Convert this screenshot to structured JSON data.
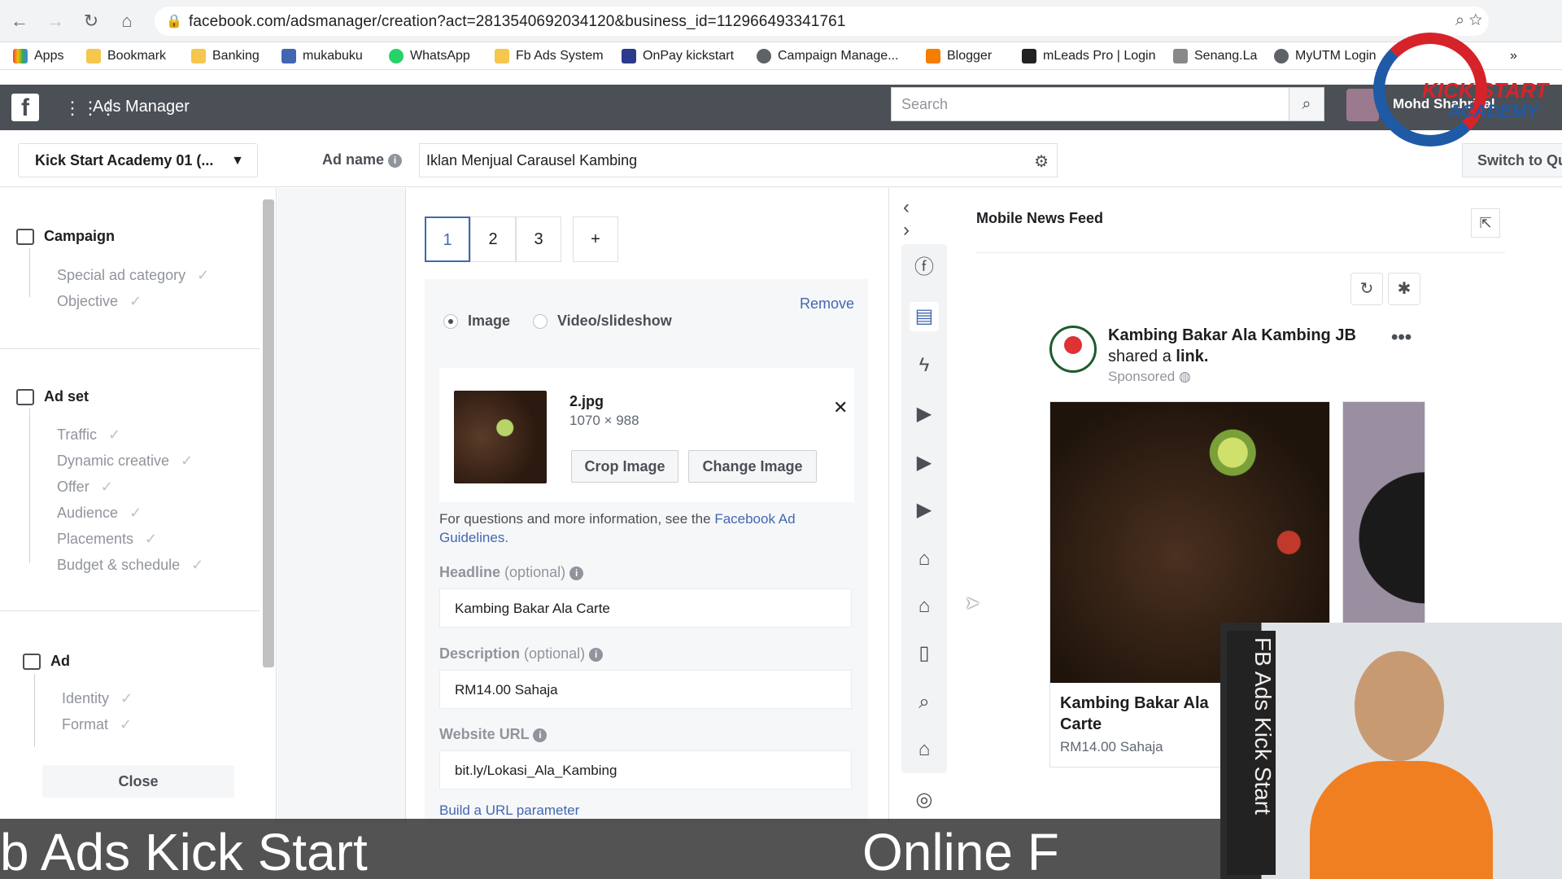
{
  "browser": {
    "url": "facebook.com/adsmanager/creation?act=2813540692034120&business_id=112966493341761",
    "bookmarks": [
      "Apps",
      "Bookmark",
      "Banking",
      "mukabuku",
      "WhatsApp",
      "Fb Ads System",
      "OnPay kickstart",
      "Campaign Manage...",
      "Blogger",
      "mLeads Pro | Login",
      "Senang.La",
      "MyUTM Login"
    ],
    "more": "»"
  },
  "header": {
    "app_title": "Ads Manager",
    "search_placeholder": "Search",
    "user_name": "Mohd Shahrizal"
  },
  "adname_row": {
    "account": "Kick Start Academy 01 (...",
    "label": "Ad name",
    "value": "Iklan Menjual Carausel Kambing",
    "switch_label": "Switch to Qu"
  },
  "leftnav": {
    "campaign": {
      "title": "Campaign",
      "items": [
        "Special ad category",
        "Objective"
      ]
    },
    "adset": {
      "title": "Ad set",
      "items": [
        "Traffic",
        "Dynamic creative",
        "Offer",
        "Audience",
        "Placements",
        "Budget & schedule"
      ]
    },
    "ad": {
      "title": "Ad",
      "items": [
        "Identity",
        "Format"
      ]
    },
    "close_label": "Close"
  },
  "editor": {
    "cards": [
      "1",
      "2",
      "3"
    ],
    "add_card": "+",
    "remove": "Remove",
    "media_types": [
      "Image",
      "Video/slideshow"
    ],
    "file_name": "2.jpg",
    "file_size": "1070 × 988",
    "crop_label": "Crop Image",
    "change_label": "Change Image",
    "help_prefix": "For questions and more information, see the",
    "help_link": "Facebook Ad Guidelines.",
    "headline_label": "Headline",
    "headline_opt": "(optional)",
    "headline_value": "Kambing Bakar Ala Carte",
    "desc_label": "Description",
    "desc_opt": "(optional)",
    "desc_value": "RM14.00 Sahaja",
    "url_label": "Website URL",
    "url_value": "bit.ly/Lokasi_Ala_Kambing",
    "build_url": "Build a URL parameter"
  },
  "preview": {
    "title": "Mobile News Feed",
    "page_name": "Kambing Bakar Ala Kambing JB",
    "shared_text": "shared a",
    "shared_link": "link.",
    "sponsored": "Sponsored",
    "card_title": "Kambing Bakar Ala Carte",
    "card_desc": "RM14.00 Sahaja"
  },
  "overlay": {
    "caption_left": "b Ads Kick Start",
    "caption_right": "Online F",
    "banner_text": "FB Ads Kick Start",
    "watermark_line1": "KICK START",
    "watermark_line2": "ACADEMY"
  },
  "colors": {
    "fb_blue": "#4267b2",
    "fb_header": "#4b4f56",
    "accent_orange": "#f07f22"
  }
}
